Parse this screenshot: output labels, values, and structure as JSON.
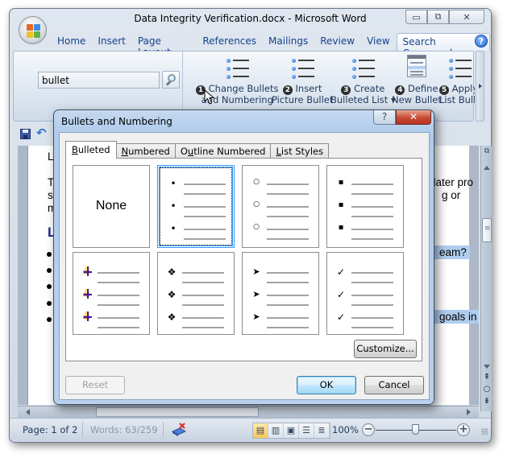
{
  "window": {
    "title": "Data Integrity Verification.docx - Microsoft Word",
    "controls": {
      "minimize": "▭",
      "restore": "⧉",
      "close": "✕"
    }
  },
  "ribbon_tabs": [
    {
      "label": "Home"
    },
    {
      "label": "Insert"
    },
    {
      "label": "Page Layout"
    },
    {
      "label": "References"
    },
    {
      "label": "Mailings"
    },
    {
      "label": "Review"
    },
    {
      "label": "View"
    },
    {
      "label": "Search Commands",
      "active": true
    }
  ],
  "help_icon": "?",
  "search": {
    "value": "bullet"
  },
  "commands": [
    {
      "num": "1",
      "line1": "Change Bullets",
      "line2": "and Numbering"
    },
    {
      "num": "2",
      "line1": "Insert",
      "line2": "Picture Bullet"
    },
    {
      "num": "3",
      "line1": "Create",
      "line2": "Bulleted List ▾"
    },
    {
      "num": "4",
      "line1": "Define",
      "line2": "New Bullet"
    },
    {
      "num": "5",
      "line1": "Apply",
      "line2": "List Bullet"
    }
  ],
  "document": {
    "line_lea": "Lea",
    "para_line1": "The",
    "para_line2": "stag",
    "para_line3": "min",
    "para_right1": "f later pro",
    "para_right2": "g or",
    "heading": "Le",
    "highlight1": "eam?",
    "highlight2": "goals in",
    "bullet_count": 5
  },
  "dialog": {
    "title": "Bullets and Numbering",
    "help": "?",
    "close": "✕",
    "tabs": [
      {
        "label": "Bulleted",
        "accel": "B",
        "active": true
      },
      {
        "label": "Numbered",
        "accel": "N"
      },
      {
        "label": "Outline Numbered",
        "accel": "u"
      },
      {
        "label": "List Styles",
        "accel": "L"
      }
    ],
    "none_label": "None",
    "bullet_styles": [
      {
        "name": "none"
      },
      {
        "name": "filled-dot",
        "symbol": "•",
        "selected": true
      },
      {
        "name": "hollow-circle",
        "symbol": "○"
      },
      {
        "name": "square",
        "symbol": "▪"
      },
      {
        "name": "picture-bullet",
        "symbol": ""
      },
      {
        "name": "four-diamond",
        "symbol": "❖"
      },
      {
        "name": "arrowhead",
        "symbol": "➤"
      },
      {
        "name": "checkmark",
        "symbol": "✓"
      }
    ],
    "buttons": {
      "customize": "Customize...",
      "reset": "Reset",
      "ok": "OK",
      "cancel": "Cancel"
    }
  },
  "statusbar": {
    "page": "Page: 1 of 2",
    "words": "Words: 63/259",
    "zoom": "100%",
    "zoom_percent": 100
  }
}
